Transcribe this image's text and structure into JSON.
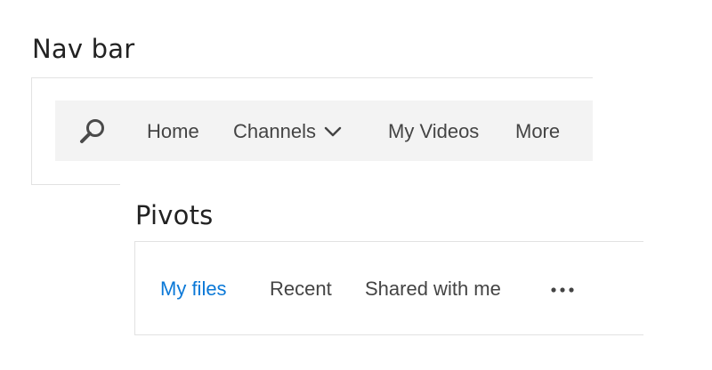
{
  "nav_section": {
    "title": "Nav bar",
    "search_icon": "search-icon",
    "items": [
      {
        "label": "Home"
      },
      {
        "label": "Channels",
        "icon": "chevron-down-icon"
      },
      {
        "label": "My Videos"
      },
      {
        "label": "More"
      }
    ],
    "bar_color": "#f3f3f3"
  },
  "pivots_section": {
    "title": "Pivots",
    "items": [
      {
        "label": "My files",
        "active": true
      },
      {
        "label": "Recent",
        "active": false
      },
      {
        "label": "Shared with me",
        "active": false
      }
    ],
    "overflow_icon": "more-horizontal-icon",
    "accent_color": "#0a78d7"
  }
}
